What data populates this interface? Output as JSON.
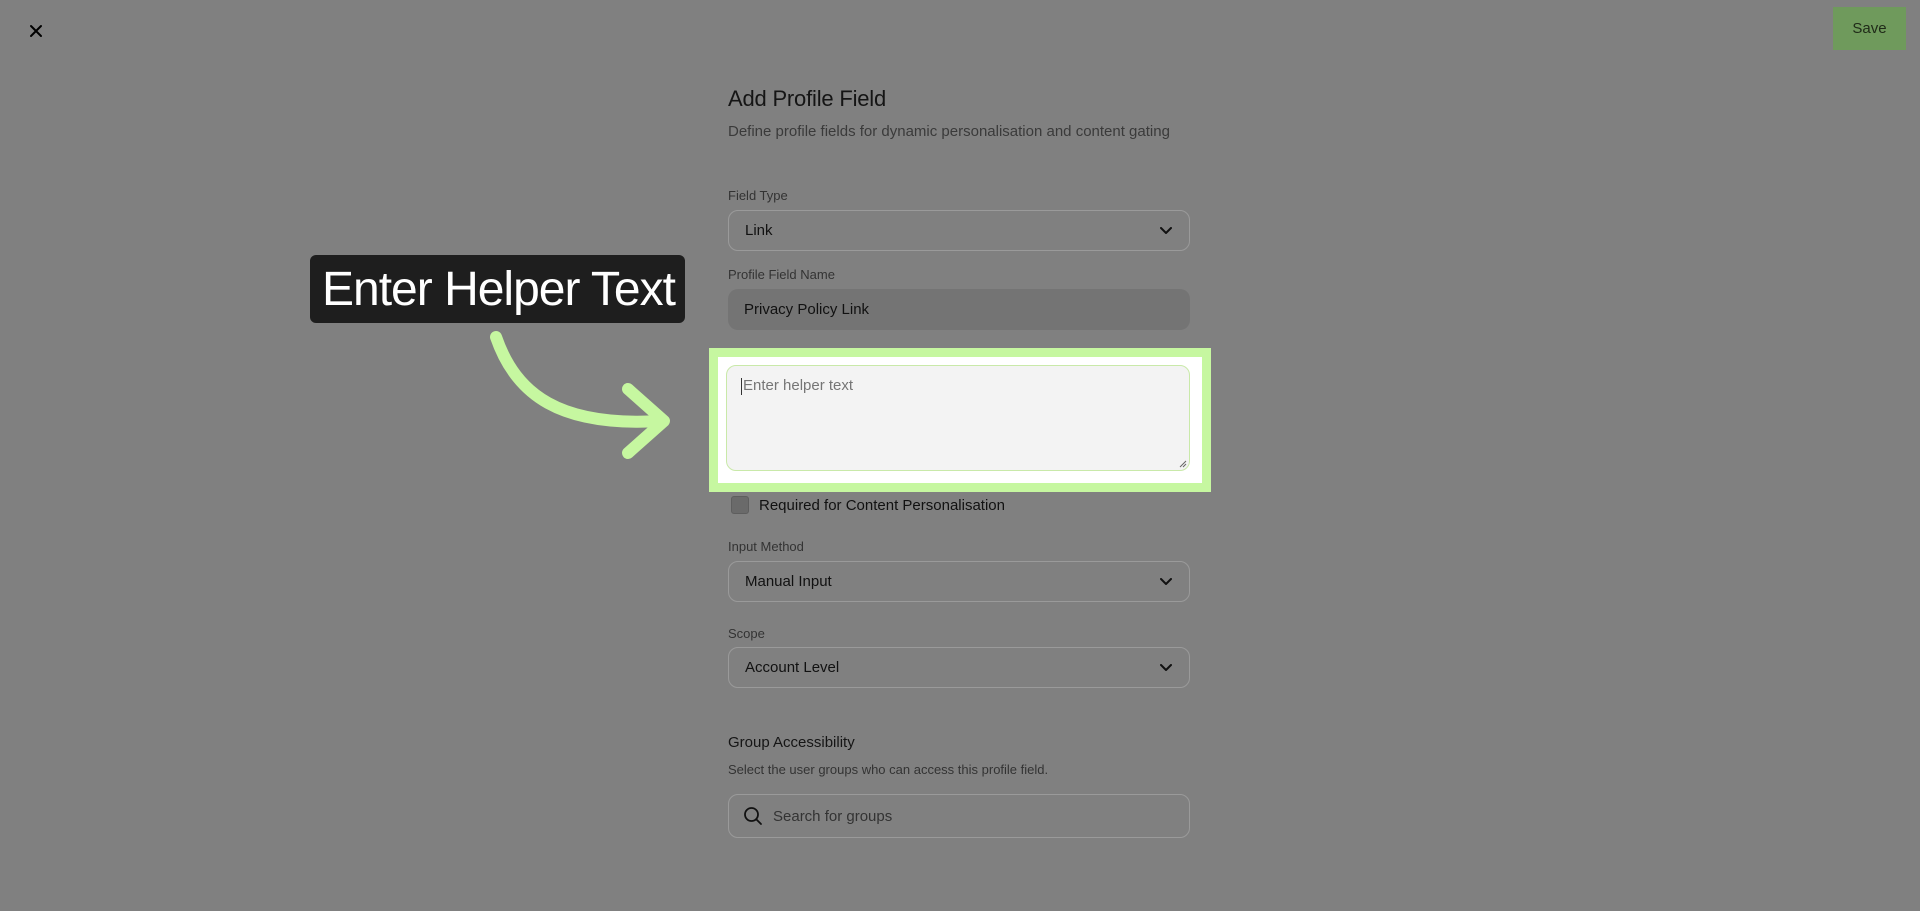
{
  "toolbar": {
    "save_label": "Save"
  },
  "form": {
    "title": "Add Profile Field",
    "subtitle": "Define profile fields for dynamic personalisation and content gating",
    "field_type": {
      "label": "Field Type",
      "value": "Link"
    },
    "profile_field_name": {
      "label": "Profile Field Name",
      "value": "Privacy Policy Link"
    },
    "helper_text": {
      "placeholder": "Enter helper text"
    },
    "required": {
      "label": "Required for Content Personalisation",
      "checked": false
    },
    "input_method": {
      "label": "Input Method",
      "value": "Manual Input"
    },
    "scope": {
      "label": "Scope",
      "value": "Account Level"
    },
    "group_accessibility": {
      "title": "Group Accessibility",
      "subtitle": "Select the user groups who can access this profile field.",
      "search_placeholder": "Search for groups"
    }
  },
  "callout": {
    "text": "Enter Helper Text"
  },
  "colors": {
    "highlight": "#c6f7a0",
    "save_button": "#6f9a5c",
    "overlay": "#808080"
  },
  "icons": [
    "close-icon",
    "chevron-down-icon",
    "search-icon",
    "arrow-icon"
  ]
}
